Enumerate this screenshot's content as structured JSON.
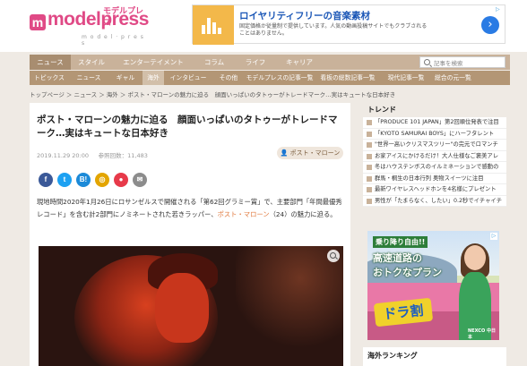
{
  "logo": {
    "wordmark": "modelpress",
    "jp": "モデルプレス",
    "sub": "m o d e l · p r e s s"
  },
  "header_ad": {
    "title": "ロイヤリティフリーの音楽素材",
    "description": "固定価格か従量制で提供しています。人気の動画投稿サイトでもクラブされることはありません。",
    "arrow": "›"
  },
  "nav_primary": [
    "ニュース",
    "スタイル",
    "エンターテイメント",
    "コラム",
    "ライフ",
    "キャリア"
  ],
  "search": {
    "placeholder": "記事を検索"
  },
  "nav_secondary": [
    "トピックス",
    "ニュース",
    "ギャル",
    "海外",
    "インタビュー",
    "その他",
    "モデルプレスの記事一覧",
    "看板の総数記事一覧",
    "現代記事一覧",
    "総合の元一覧"
  ],
  "breadcrumb": "トップページ ＞ ニュース ＞ 海外 ＞ ポスト・マローンの魅力に迫る　顔面いっぱいのタトゥーがトレードマーク…実はキュートな日本好き",
  "article": {
    "title": "ポスト・マローンの魅力に迫る　顔面いっぱいのタトゥーがトレードマーク…実はキュートな日本好き",
    "date": "2019.11.29 20:00",
    "views": "参照回数：11,483",
    "tag": "ポスト・マローン",
    "share": [
      {
        "label": "f",
        "color": "#3b5998"
      },
      {
        "label": "t",
        "color": "#1da1f2"
      },
      {
        "label": "B!",
        "color": "#1c8ad8"
      },
      {
        "label": "◎",
        "color": "#e3a500"
      },
      {
        "label": "●",
        "color": "#e73a4a"
      },
      {
        "label": "✉",
        "color": "#8c8c8c"
      }
    ],
    "body_pre": "現地時間2020年1月26日にロサンゼルスで開催される「第62回グラミー賞」で、主要部門「年間最優秀レコード」を含む計2部門にノミネートされた若きラッパー、",
    "body_link": "ポスト・マローン",
    "body_post": "（24）の魅力に迫る。"
  },
  "sidebar": {
    "trend_heading": "トレンド",
    "trends": [
      "「PRODUCE 101 JAPAN」第2回順位発表で注目",
      "「KYOTO SAMURAI BOYS」にハーフタレント",
      "\"世界一高いクリスマスツリー\"の完元でロマンチ",
      "お家アイスにかけるだけ！大人仕様なご褒美アレ",
      "冬はハウステンボスのイルミネーションで感動の",
      "群馬・桐生の日本行列 奥物スイーツに注目",
      "最新ワイヤレスヘッドホンを4名様にプレゼント",
      "男性が「たまらなく、したい」0.2秒でイチャイチ"
    ],
    "ad": {
      "line1": "乗り降り自由!!",
      "line2": "高速道路の",
      "line3": "おトクなプラン",
      "badge": "ドラ割",
      "sponsor": "NEXCO 中日本"
    },
    "ranking_heading": "海外ランキング"
  },
  "colors": {
    "brand": "#e04a86",
    "nav": "#c9b29a",
    "nav2": "#b39675",
    "link": "#e0783c"
  }
}
